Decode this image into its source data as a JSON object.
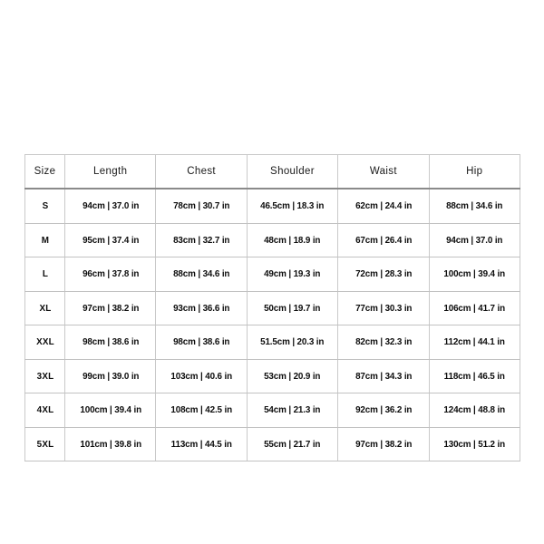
{
  "table": {
    "columns": [
      "Size",
      "Length",
      "Chest",
      "Shoulder",
      "Waist",
      "Hip"
    ],
    "rows": [
      {
        "size": "S",
        "length": "94cm | 37.0 in",
        "chest": "78cm | 30.7 in",
        "shoulder": "46.5cm | 18.3 in",
        "waist": "62cm | 24.4 in",
        "hip": "88cm | 34.6 in"
      },
      {
        "size": "M",
        "length": "95cm | 37.4 in",
        "chest": "83cm | 32.7 in",
        "shoulder": "48cm | 18.9 in",
        "waist": "67cm | 26.4 in",
        "hip": "94cm | 37.0 in"
      },
      {
        "size": "L",
        "length": "96cm | 37.8 in",
        "chest": "88cm | 34.6 in",
        "shoulder": "49cm | 19.3 in",
        "waist": "72cm | 28.3 in",
        "hip": "100cm | 39.4 in"
      },
      {
        "size": "XL",
        "length": "97cm | 38.2 in",
        "chest": "93cm | 36.6 in",
        "shoulder": "50cm | 19.7 in",
        "waist": "77cm | 30.3 in",
        "hip": "106cm | 41.7 in"
      },
      {
        "size": "XXL",
        "length": "98cm | 38.6 in",
        "chest": "98cm | 38.6 in",
        "shoulder": "51.5cm | 20.3 in",
        "waist": "82cm | 32.3 in",
        "hip": "112cm | 44.1 in"
      },
      {
        "size": "3XL",
        "length": "99cm | 39.0 in",
        "chest": "103cm | 40.6 in",
        "shoulder": "53cm | 20.9 in",
        "waist": "87cm | 34.3 in",
        "hip": "118cm | 46.5 in"
      },
      {
        "size": "4XL",
        "length": "100cm | 39.4 in",
        "chest": "108cm | 42.5 in",
        "shoulder": "54cm | 21.3 in",
        "waist": "92cm | 36.2 in",
        "hip": "124cm | 48.8 in"
      },
      {
        "size": "5XL",
        "length": "101cm | 39.8 in",
        "chest": "113cm | 44.5 in",
        "shoulder": "55cm | 21.7 in",
        "waist": "97cm | 38.2 in",
        "hip": "130cm | 51.2 in"
      }
    ]
  },
  "chart_data": {
    "type": "table",
    "title": "",
    "columns": [
      "Size",
      "Length",
      "Chest",
      "Shoulder",
      "Waist",
      "Hip"
    ],
    "units": [
      "",
      "cm | in",
      "cm | in",
      "cm | in",
      "cm | in",
      "cm | in"
    ],
    "categories": [
      "S",
      "M",
      "L",
      "XL",
      "XXL",
      "3XL",
      "4XL",
      "5XL"
    ],
    "series": [
      {
        "name": "Length (cm)",
        "values": [
          94,
          95,
          96,
          97,
          98,
          99,
          100,
          101
        ]
      },
      {
        "name": "Length (in)",
        "values": [
          37.0,
          37.4,
          37.8,
          38.2,
          38.6,
          39.0,
          39.4,
          39.8
        ]
      },
      {
        "name": "Chest (cm)",
        "values": [
          78,
          83,
          88,
          93,
          98,
          103,
          108,
          113
        ]
      },
      {
        "name": "Chest (in)",
        "values": [
          30.7,
          32.7,
          34.6,
          36.6,
          38.6,
          40.6,
          42.5,
          44.5
        ]
      },
      {
        "name": "Shoulder (cm)",
        "values": [
          46.5,
          48,
          49,
          50,
          51.5,
          53,
          54,
          55
        ]
      },
      {
        "name": "Shoulder (in)",
        "values": [
          18.3,
          18.9,
          19.3,
          19.7,
          20.3,
          20.9,
          21.3,
          21.7
        ]
      },
      {
        "name": "Waist (cm)",
        "values": [
          62,
          67,
          72,
          77,
          82,
          87,
          92,
          97
        ]
      },
      {
        "name": "Waist (in)",
        "values": [
          24.4,
          26.4,
          28.3,
          30.3,
          32.3,
          34.3,
          36.2,
          38.2
        ]
      },
      {
        "name": "Hip (cm)",
        "values": [
          88,
          94,
          100,
          106,
          112,
          118,
          124,
          130
        ]
      },
      {
        "name": "Hip (in)",
        "values": [
          34.6,
          37.0,
          39.4,
          41.7,
          44.1,
          46.5,
          48.8,
          51.2
        ]
      }
    ]
  }
}
